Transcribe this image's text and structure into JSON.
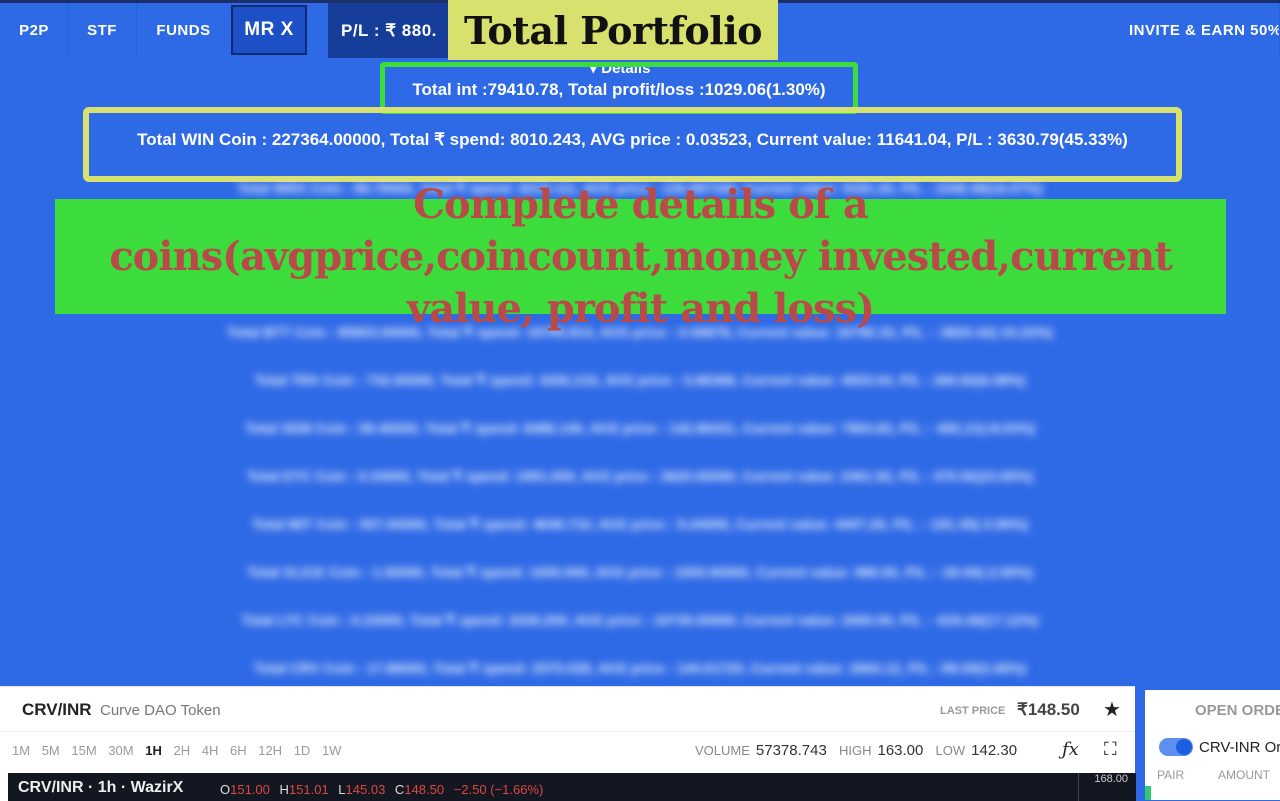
{
  "nav": {
    "p2p": "P2P",
    "stf": "STF",
    "funds": "FUNDS",
    "mrx": "MR X",
    "pl": "P/L : ₹ 880.",
    "invite": "INVITE & EARN 50%"
  },
  "callouts": {
    "total_portfolio": "Total Portfolio",
    "complete_details": "Complete details of a coins(avgprice,coincount,money invested,current value, profit and loss)"
  },
  "portfolio": {
    "details_toggle": "▾ Details",
    "total_int": "Total int :79410.78, Total profit/loss :1029.06(1.30%)",
    "win_line": "Total WIN Coin : 227364.00000, Total ₹ spend: 8010.243, AVG price : 0.03523, Current value: 11641.04, P/L : 3630.79(45.33%)",
    "blurred_rows": [
      "Total WRX Coin : 89.79000, Total ₹ spend: 8219.111, AVG price : 126.997165, Current value: 9181.20, P/L : 1048.49(16.07%)",
      "Total BTT Coin : 85803.00000, Total ₹ spend: 19795.814, AVG price : 0.06878, Current value: 16790.33, P/L : -3820.42(-15.22%)",
      "Total TRX Coin : 732.00000, Total ₹ spend: 4292.216, AVG price : 5.86368, Current value: 4553.04, P/L : 260.82(6.08%)",
      "Total XEM Coin : 59.40000, Total ₹ spend: 8486.140, AVG price : 142.86431, Current value: 7804.83, P/L : -681.21(-8.03%)",
      "Total ETC Coin : 0.33000, Total ₹ spend: 1991.000, AVG price : 3620.00000, Current value: 2461.92, P/L : 470.92(23.65%)",
      "Total MIT Coin : 507.00000, Total ₹ spend: 4646.710, AVG price : 9.24059, Current value: 4407.26, P/L : -181.45(-3.90%)",
      "Total XLICE Coin : 1.00000, Total ₹ spend: 1000.000, AVG price : 1000.00000, Current value: 980.00, P/L : -20.00(-2.00%)",
      "Total LTC Coin : 0.23000, Total ₹ spend: 2026.200, AVG price : 10730.00000, Current value: 2000.00, P/L : -633.46(17.12%)",
      "Total CRV Coin : 17.88000, Total ₹ spend: 2575.028, AVG price : 144.01720, Current value: 2664.12, P/L : 89.09(3.46%)"
    ]
  },
  "ticker": {
    "pair": "CRV/INR",
    "pair_full": "Curve DAO Token",
    "last_price_label": "LAST PRICE",
    "last_price": "₹148.50",
    "timeframes": [
      "1M",
      "5M",
      "15M",
      "30M",
      "1H",
      "2H",
      "4H",
      "6H",
      "12H",
      "1D",
      "1W"
    ],
    "active_timeframe": "1H",
    "volume_label": "VOLUME",
    "volume": "57378.743",
    "high_label": "HIGH",
    "high": "163.00",
    "low_label": "LOW",
    "low": "142.30"
  },
  "chart": {
    "title": "CRV/INR · 1h · WazirX",
    "o": "151.00",
    "h": "151.01",
    "l": "145.03",
    "c": "148.50",
    "change": "−2.50 (−1.66%)",
    "axis_top": "168.00"
  },
  "orders": {
    "title": "OPEN ORDERS",
    "toggle_label": "CRV-INR Orders",
    "col_pair": "PAIR",
    "col_amount": "AMOUNT"
  },
  "colors": {
    "background": "#2f6ae6",
    "yellow_callout": "#d8e06e",
    "green_callout": "#3ddc3d",
    "negative": "#e0463f"
  }
}
